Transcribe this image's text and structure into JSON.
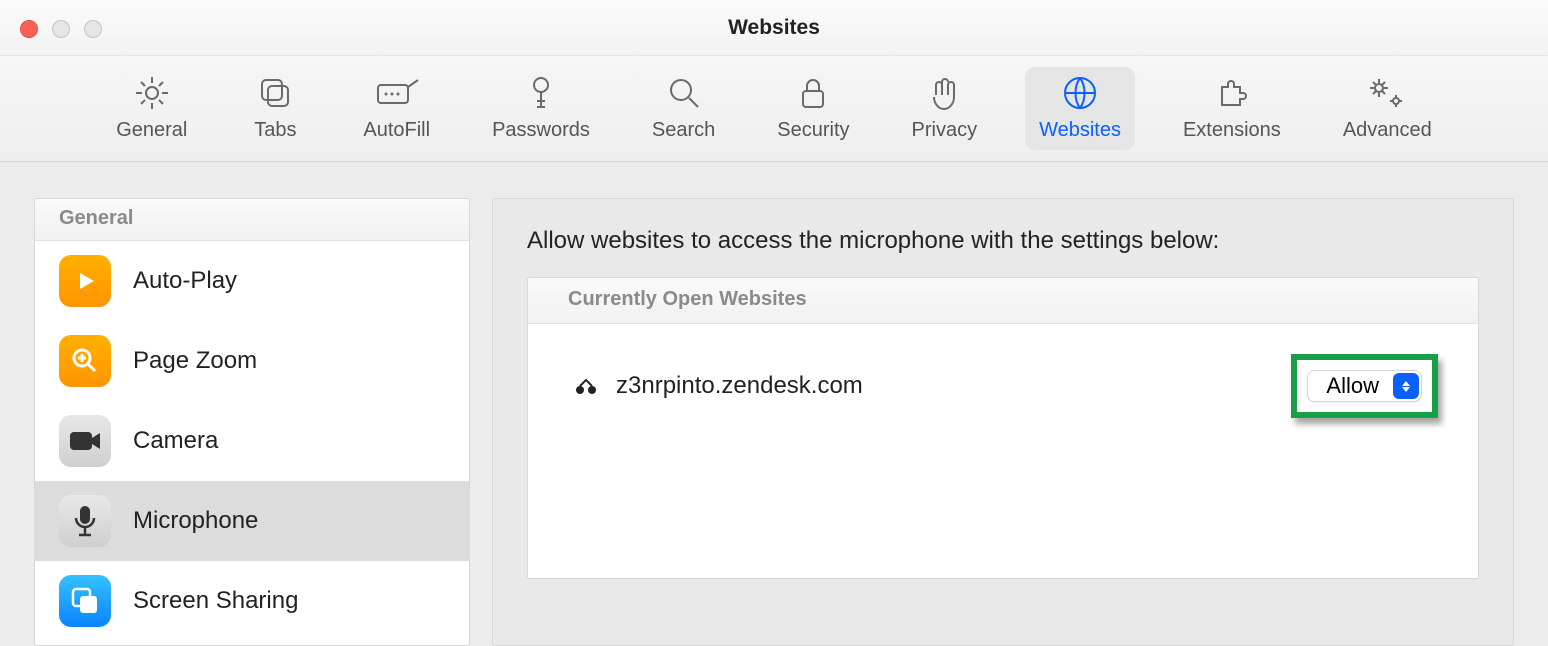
{
  "window": {
    "title": "Websites"
  },
  "toolbar": {
    "items": [
      {
        "label": "General"
      },
      {
        "label": "Tabs"
      },
      {
        "label": "AutoFill"
      },
      {
        "label": "Passwords"
      },
      {
        "label": "Search"
      },
      {
        "label": "Security"
      },
      {
        "label": "Privacy"
      },
      {
        "label": "Websites"
      },
      {
        "label": "Extensions"
      },
      {
        "label": "Advanced"
      }
    ]
  },
  "sidebar": {
    "section_label": "General",
    "items": [
      {
        "label": "Auto-Play"
      },
      {
        "label": "Page Zoom"
      },
      {
        "label": "Camera"
      },
      {
        "label": "Microphone"
      },
      {
        "label": "Screen Sharing"
      }
    ]
  },
  "main": {
    "heading": "Allow websites to access the microphone with the settings below:",
    "table_header": "Currently Open Websites",
    "rows": [
      {
        "domain": "z3nrpinto.zendesk.com",
        "permission": "Allow"
      }
    ]
  }
}
